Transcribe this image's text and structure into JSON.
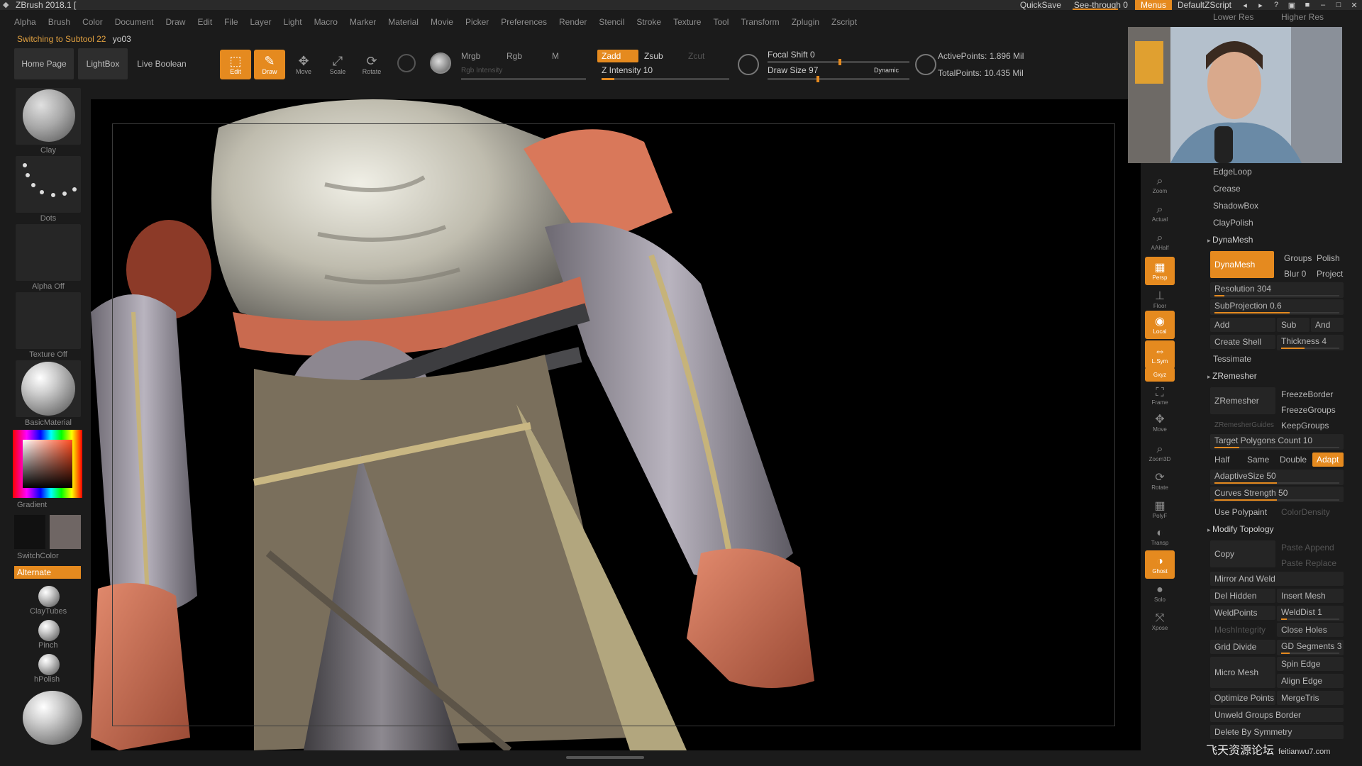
{
  "window": {
    "app_title": "ZBrush 2018.1 [",
    "quicksave": "QuickSave",
    "see_through": "See-through  0",
    "menus": "Menus",
    "default_script": "DefaultZScript"
  },
  "menubar": [
    "Alpha",
    "Brush",
    "Color",
    "Document",
    "Draw",
    "Edit",
    "File",
    "Layer",
    "Light",
    "Macro",
    "Marker",
    "Material",
    "Movie",
    "Picker",
    "Preferences",
    "Render",
    "Stencil",
    "Stroke",
    "Texture",
    "Tool",
    "Transform",
    "Zplugin",
    "Zscript"
  ],
  "info": {
    "status": "Switching to Subtool 22",
    "tool_name": "yo03"
  },
  "shelf": {
    "home_page": "Home Page",
    "lightbox": "LightBox",
    "live_boolean": "Live Boolean",
    "edit": "Edit",
    "draw": "Draw",
    "move": "Move",
    "scale": "Scale",
    "rotate": "Rotate",
    "mrgb": "Mrgb",
    "rgb": "Rgb",
    "m": "M",
    "rgb_intensity": "Rgb Intensity",
    "zadd": "Zadd",
    "zsub": "Zsub",
    "zcut": "Zcut",
    "z_intensity": "Z Intensity 10",
    "focal_shift": "Focal Shift 0",
    "draw_size": "Draw Size 97",
    "dynamic": "Dynamic",
    "active_points": "ActivePoints: 1.896 Mil",
    "total_points": "TotalPoints: 10.435 Mil",
    "z_intensity_value": 10,
    "focal_shift_value": 0,
    "draw_size_value": 97
  },
  "lefttray": {
    "brush": "Clay",
    "stroke": "Dots",
    "alpha": "Alpha Off",
    "texture": "Texture Off",
    "material": "BasicMaterial",
    "gradient": "Gradient",
    "switchcolor": "SwitchColor",
    "alternate": "Alternate",
    "recent_brushes": [
      "ClayTubes",
      "Pinch",
      "hPolish"
    ]
  },
  "rightshelf": [
    "Zoom",
    "Actual",
    "AAHalf",
    "Persp",
    "Floor",
    "Local",
    "L.Sym",
    "Gxyz",
    "Frame",
    "Move",
    "Zoom3D",
    "Rotate",
    "PolyF",
    "Transp",
    "Ghost",
    "Solo",
    "Xpose"
  ],
  "palette": {
    "lower_res": "Lower Res",
    "higher_res": "Higher Res",
    "rows_top": [
      "EdgeLoop",
      "Crease",
      "ShadowBox",
      "ClayPolish"
    ],
    "dynamesh_section": "DynaMesh",
    "dynamesh_btn": "DynaMesh",
    "groups": "Groups",
    "polish": "Polish",
    "blur": "Blur 0",
    "project": "Project",
    "resolution": "Resolution 304",
    "subprojection": "SubProjection 0.6",
    "add": "Add",
    "sub": "Sub",
    "and": "And",
    "create_shell": "Create Shell",
    "thickness": "Thickness 4",
    "tessimate": "Tessimate",
    "zremesher_section": "ZRemesher",
    "zremesher_btn": "ZRemesher",
    "freezeborder": "FreezeBorder",
    "freezegroups": "FreezeGroups",
    "zremesher_guides": "ZRemesherGuides",
    "keepgroups": "KeepGroups",
    "target_poly": "Target Polygons Count 10",
    "half": "Half",
    "same": "Same",
    "double": "Double",
    "adapt": "Adapt",
    "adaptive_size": "AdaptiveSize 50",
    "curves_strength": "Curves Strength 50",
    "use_polypaint": "Use Polypaint",
    "color_density": "ColorDensity",
    "modify_topology_section": "Modify Topology",
    "copy": "Copy",
    "paste_append": "Paste Append",
    "paste_replace": "Paste Replace",
    "mirror_weld": "Mirror And Weld",
    "del_hidden": "Del Hidden",
    "insert_mesh": "Insert Mesh",
    "weldpoints": "WeldPoints",
    "welddist": "WeldDist 1",
    "meshintegrity": "MeshIntegrity",
    "close_holes": "Close Holes",
    "grid_divide": "Grid Divide",
    "gd_segments": "GD Segments 3",
    "spin_edge": "Spin Edge",
    "micro_mesh": "Micro Mesh",
    "align_edge": "Align Edge",
    "optimize_points": "Optimize Points",
    "mergetris": "MergeTris",
    "unweld_groups": "Unweld Groups Border",
    "delete_symmetry": "Delete By Symmetry"
  },
  "watermark": {
    "main": "飞天资源论坛",
    "sub": "feitianwu7.com"
  },
  "colors": {
    "accent": "#e58a1f",
    "bg": "#1b1b1b",
    "panel": "#252525"
  }
}
